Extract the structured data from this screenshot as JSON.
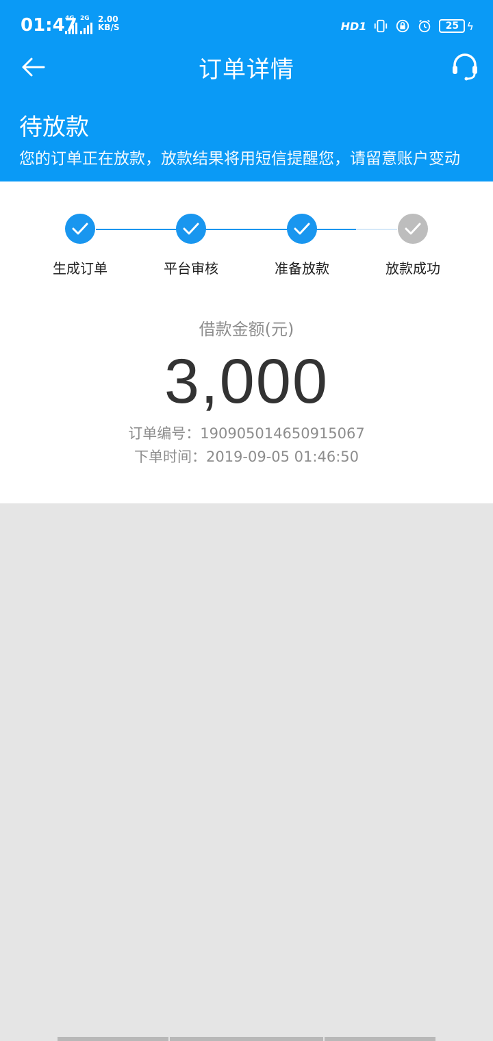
{
  "status_bar": {
    "time": "01:47",
    "signal_1": "4G",
    "signal_2": "2G",
    "net_speed_value": "2.00",
    "net_speed_unit": "KB/S",
    "hd_label": "HD1",
    "battery": "25"
  },
  "nav": {
    "title": "订单详情"
  },
  "order_status": {
    "title": "待放款",
    "description": "您的订单正在放款，放款结果将用短信提醒您，请留意账户变动"
  },
  "steps": [
    {
      "label": "生成订单",
      "done": true
    },
    {
      "label": "平台审核",
      "done": true
    },
    {
      "label": "准备放款",
      "done": true
    },
    {
      "label": "放款成功",
      "done": false
    }
  ],
  "loan": {
    "amount_label": "借款金额(元)",
    "amount": "3,000",
    "order_no_label": "订单编号：",
    "order_no": "190905014650915067",
    "time_label": "下单时间：",
    "time": "2019-09-05 01:46:50"
  },
  "colors": {
    "primary": "#0a9af6",
    "step_done": "#1996ef",
    "step_pending": "#bdbdbd",
    "page_bg": "#e5e5e5"
  }
}
